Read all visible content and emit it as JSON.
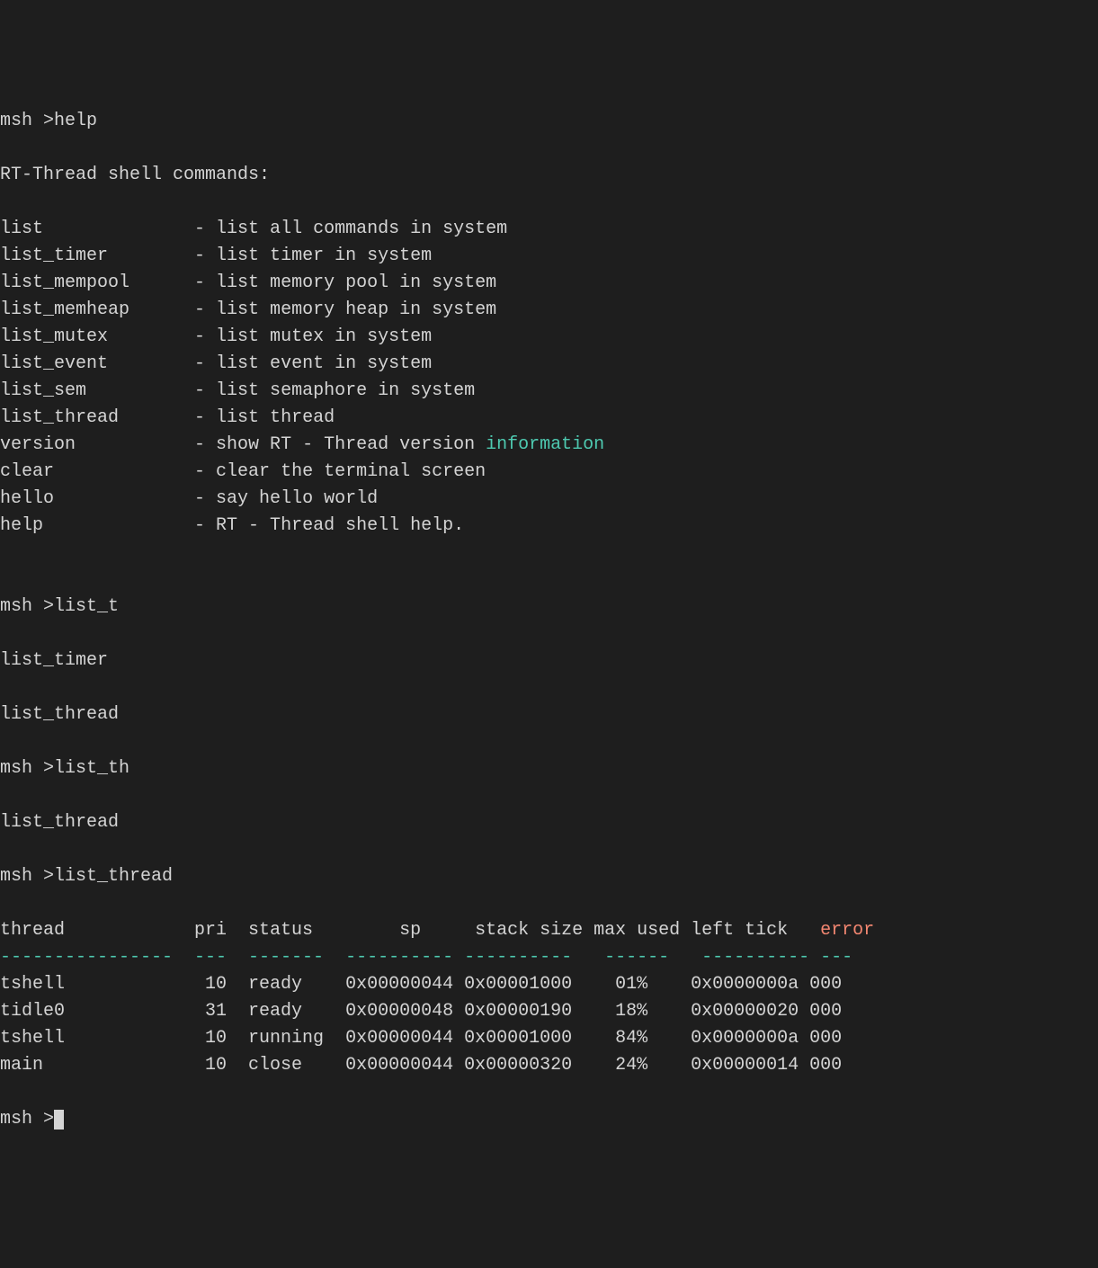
{
  "prompt": "msh >",
  "cmd_help": "help",
  "help_header": "RT-Thread shell commands:",
  "help_items": [
    {
      "name": "list",
      "desc": "- list all commands in system"
    },
    {
      "name": "list_timer",
      "desc": "- list timer in system"
    },
    {
      "name": "list_mempool",
      "desc": "- list memory pool in system"
    },
    {
      "name": "list_memheap",
      "desc": "- list memory heap in system"
    },
    {
      "name": "list_mutex",
      "desc": "- list mutex in system"
    },
    {
      "name": "list_event",
      "desc": "- list event in system"
    },
    {
      "name": "list_sem",
      "desc": "- list semaphore in system"
    },
    {
      "name": "list_thread",
      "desc": "- list thread"
    },
    {
      "name": "version",
      "desc": "- show RT - Thread version ",
      "keyword": "information"
    },
    {
      "name": "clear",
      "desc": "- clear the terminal screen"
    },
    {
      "name": "hello",
      "desc": "- say hello world"
    },
    {
      "name": "help",
      "desc": "- RT - Thread shell help."
    }
  ],
  "blank": "",
  "cmd_list_t": "list_t",
  "completion1": "list_timer",
  "completion2": "list_thread",
  "cmd_list_th": "list_th",
  "completion3": "list_thread",
  "cmd_list_thread": "list_thread",
  "thread_table": {
    "headers": [
      "thread",
      "pri",
      "status",
      "sp",
      "stack size",
      "max used",
      "left tick",
      "error"
    ],
    "separators": [
      "----------------",
      "---",
      "-------",
      "----------",
      "----------",
      "------",
      "----------",
      "---"
    ],
    "rows": [
      {
        "thread": "tshell",
        "pri": "10",
        "status": "ready",
        "sp": "0x00000044",
        "stack_size": "0x00001000",
        "max_used": "01%",
        "left_tick": "0x0000000a",
        "error": "000"
      },
      {
        "thread": "tidle0",
        "pri": "31",
        "status": "ready",
        "sp": "0x00000048",
        "stack_size": "0x00000190",
        "max_used": "18%",
        "left_tick": "0x00000020",
        "error": "000"
      },
      {
        "thread": "tshell",
        "pri": "10",
        "status": "running",
        "sp": "0x00000044",
        "stack_size": "0x00001000",
        "max_used": "84%",
        "left_tick": "0x0000000a",
        "error": "000"
      },
      {
        "thread": "main",
        "pri": "10",
        "status": "close",
        "sp": "0x00000044",
        "stack_size": "0x00000320",
        "max_used": "24%",
        "left_tick": "0x00000014",
        "error": "000"
      }
    ]
  }
}
